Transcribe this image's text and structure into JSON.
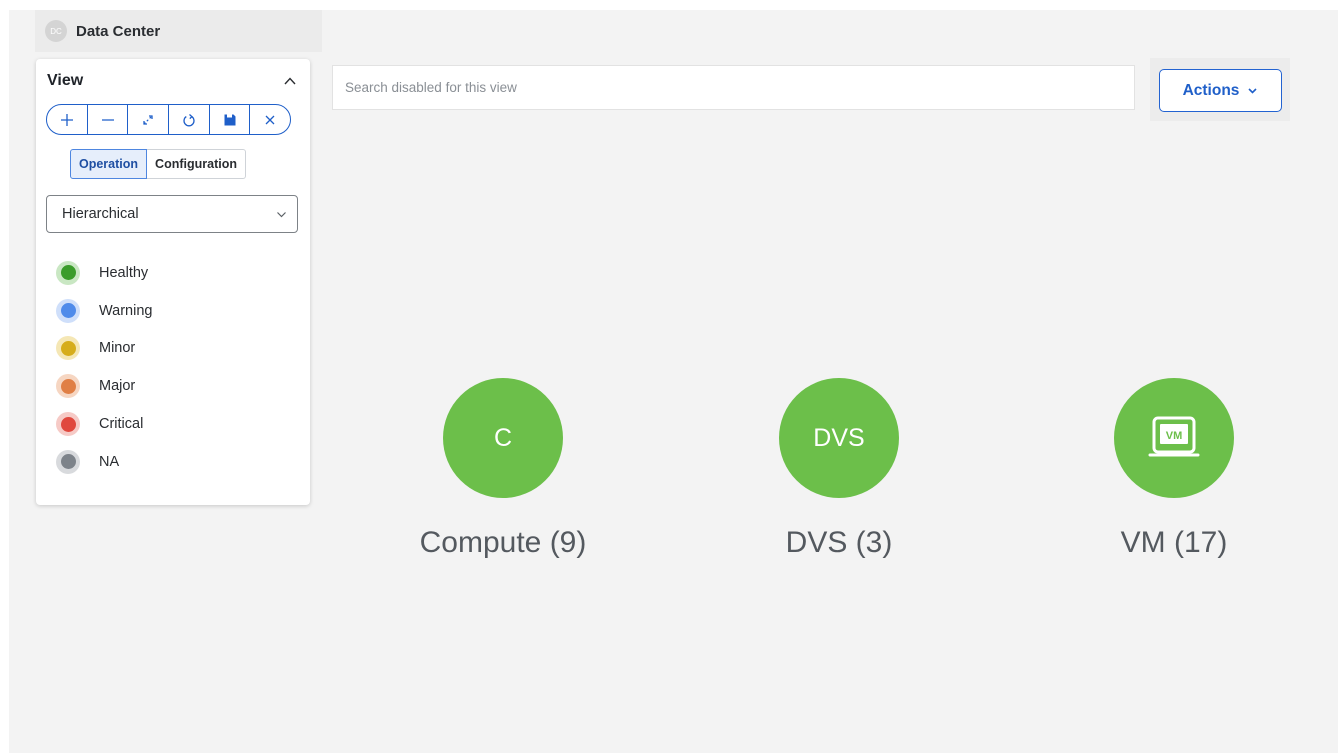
{
  "breadcrumb": {
    "avatar": "DC",
    "title": "Data Center"
  },
  "panel": {
    "title": "View",
    "tools": [
      "zoom-in",
      "zoom-out",
      "fit-to-screen",
      "refresh",
      "save",
      "close"
    ],
    "modes": {
      "active": "Operation",
      "inactive": "Configuration"
    },
    "layout_select": "Hierarchical",
    "legend": [
      {
        "label": "Healthy",
        "color": "#3a9c2a",
        "ring": "#c9e7c3"
      },
      {
        "label": "Warning",
        "color": "#4f8bea",
        "ring": "#cfdffa"
      },
      {
        "label": "Minor",
        "color": "#d6ad1c",
        "ring": "#f5e7b5"
      },
      {
        "label": "Major",
        "color": "#e07f45",
        "ring": "#f6d6c2"
      },
      {
        "label": "Critical",
        "color": "#e0483e",
        "ring": "#f6cac6"
      },
      {
        "label": "NA",
        "color": "#7d838a",
        "ring": "#d8dadd"
      }
    ]
  },
  "search": {
    "placeholder": "Search disabled for this view"
  },
  "actions": {
    "label": "Actions"
  },
  "nodes": [
    {
      "glyph": "C",
      "label": "Compute (9)",
      "status": "Healthy"
    },
    {
      "glyph": "DVS",
      "label": "DVS (3)",
      "status": "Healthy"
    },
    {
      "glyph": "VM",
      "label": "VM (17)",
      "status": "Healthy"
    }
  ]
}
